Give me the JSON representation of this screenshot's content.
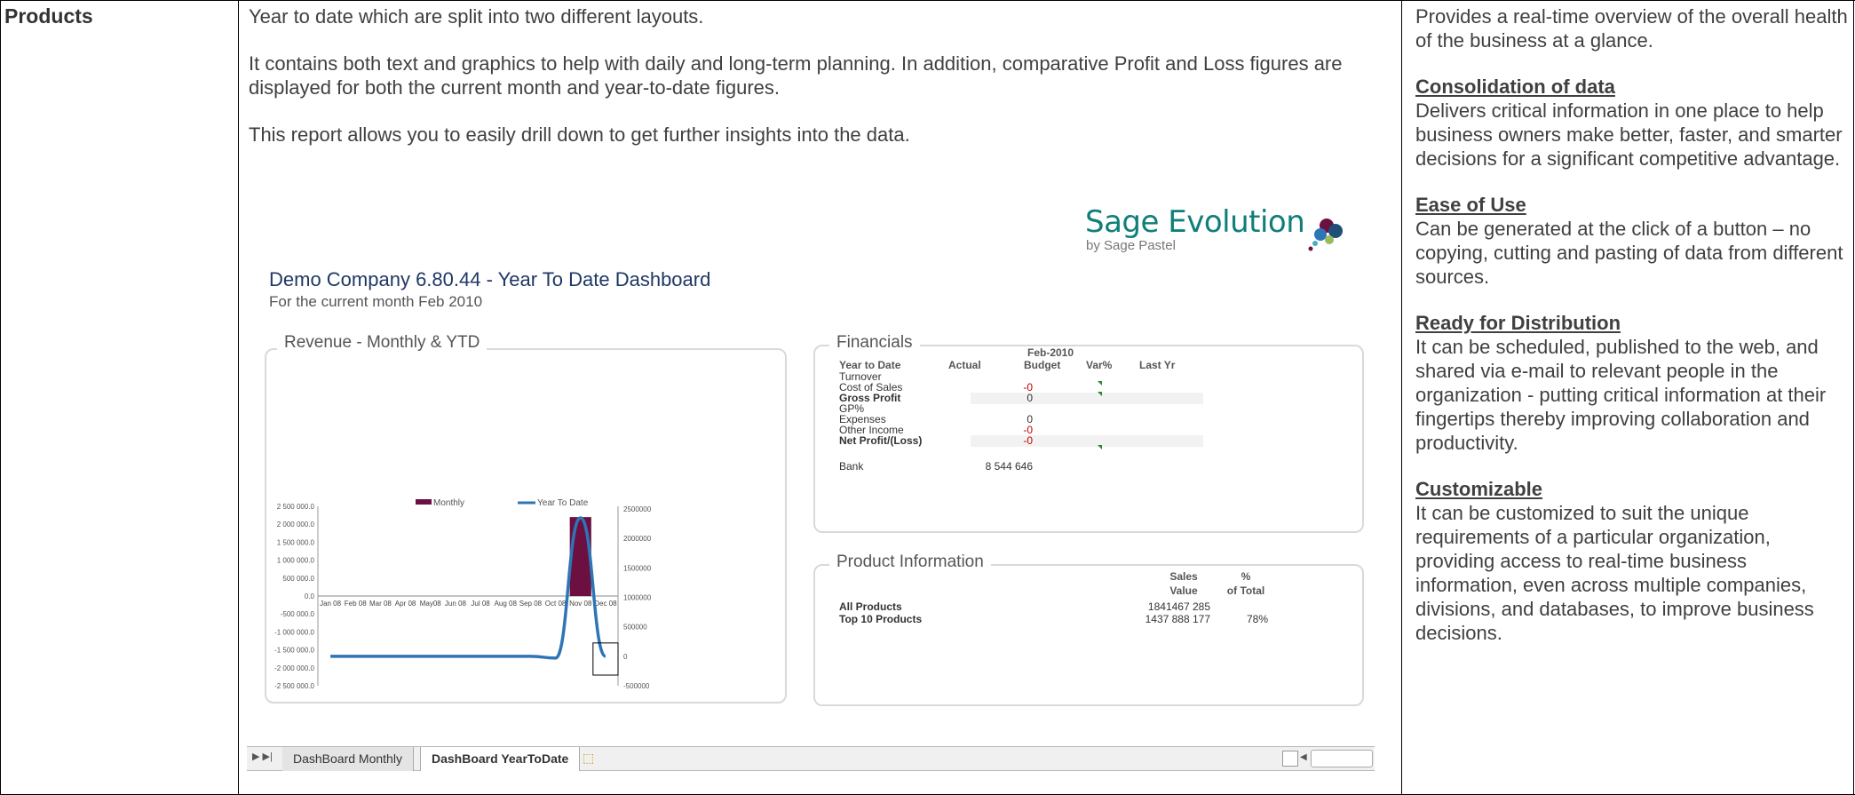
{
  "row_label": "Products",
  "description": {
    "p1": "Year to date which are split into two different layouts.",
    "p2": "It contains both text and graphics to help with daily and long-term planning. In addition, comparative Profit and Loss figures are displayed for both the current month and year-to-date figures.",
    "p3": "This report allows you to easily drill down to get further insights into the data."
  },
  "benefits": {
    "intro": "Provides a real-time overview of the overall health of the business at a glance.",
    "items": [
      {
        "heading": "Consolidation of data",
        "text": "Delivers critical information in one place to help business owners make better, faster, and smarter decisions for a significant competitive advantage."
      },
      {
        "heading": "Ease of Use",
        "text": "Can be generated at the click of a button – no copying, cutting and pasting of data from different sources."
      },
      {
        "heading": "Ready for Distribution",
        "text": "It can be scheduled, published to the web, and shared via e-mail to relevant people in the organization - putting critical information at their fingertips thereby improving collaboration and productivity."
      },
      {
        "heading": "Customizable",
        "text": "It can be customized to suit the unique requirements of a particular organization, providing access to real-time business information, even across multiple companies, divisions, and databases, to improve business decisions."
      }
    ]
  },
  "dashboard": {
    "logo_text": "Sage Evolution",
    "logo_sub": "by Sage Pastel",
    "title": "Demo Company 6.80.44 - Year To Date Dashboard",
    "subtitle": "For the current month Feb 2010",
    "revenue_panel_title": "Revenue  - Monthly  & YTD",
    "financials_panel_title": "Financials",
    "product_panel_title": "Product  Information",
    "financials": {
      "period": "Feb-2010",
      "headers": [
        "Year to Date",
        "Actual",
        "Budget",
        "Var%",
        "Last Yr"
      ],
      "rows": [
        {
          "label": "Turnover",
          "actual": "",
          "bold": false
        },
        {
          "label": "Cost of Sales",
          "actual": "-0",
          "bold": false,
          "red": true
        },
        {
          "label": "Gross Profit",
          "actual": "0",
          "bold": true
        },
        {
          "label": "GP%",
          "actual": "",
          "bold": false
        },
        {
          "label": "Expenses",
          "actual": "0",
          "bold": false
        },
        {
          "label": "Other Income",
          "actual": "-0",
          "bold": false,
          "red": true
        },
        {
          "label": "Net Profit/(Loss)",
          "actual": "-0",
          "bold": true,
          "red": true
        }
      ],
      "bank_label": "Bank",
      "bank_value": "8 544 646"
    },
    "product_info": {
      "headers": [
        "Sales",
        "Value",
        "%",
        "of Total"
      ],
      "rows": [
        {
          "label": "All Products",
          "value": "1841467 285",
          "pct": ""
        },
        {
          "label": "Top 10 Products",
          "value": "1437 888 177",
          "pct": "78%"
        }
      ]
    },
    "tabs": {
      "inactive": "DashBoard Monthly",
      "active": "DashBoard YearToDate"
    }
  },
  "chart_data": {
    "type": "bar",
    "title": "Revenue  - Monthly  & YTD",
    "categories": [
      "Jan 08",
      "Feb 08",
      "Mar 08",
      "Apr 08",
      "May08",
      "Jun 08",
      "Jul 08",
      "Aug 08",
      "Sep 08",
      "Oct 08",
      "Nov 08",
      "Dec 08"
    ],
    "series": [
      {
        "name": "Monthly",
        "type": "bar",
        "axis": "left",
        "values": [
          0,
          0,
          0,
          0,
          0,
          0,
          0,
          0,
          0,
          0,
          2200000,
          0
        ]
      },
      {
        "name": "Year To Date",
        "type": "line",
        "axis": "right",
        "values": [
          0,
          0,
          0,
          0,
          0,
          0,
          0,
          0,
          0,
          -30000,
          2350000,
          0
        ]
      }
    ],
    "left_ticks": [
      "2 500 000.0",
      "2 000 000.0",
      "1 500 000.0",
      "1 000 000.0",
      "500 000.0",
      "0.0",
      "-500 000.0",
      "-1 000 000.0",
      "-1 500 000.0",
      "-2 000 000.0",
      "-2 500 000.0"
    ],
    "right_ticks": [
      "2500000",
      "2000000",
      "1500000",
      "1000000",
      "500000",
      "0",
      "-500000"
    ],
    "ylim_left": [
      -2500000,
      2500000
    ],
    "ylim_right": [
      -500000,
      2500000
    ],
    "colors": {
      "Monthly": "#6b1040",
      "Year To Date": "#2e75b6"
    }
  }
}
